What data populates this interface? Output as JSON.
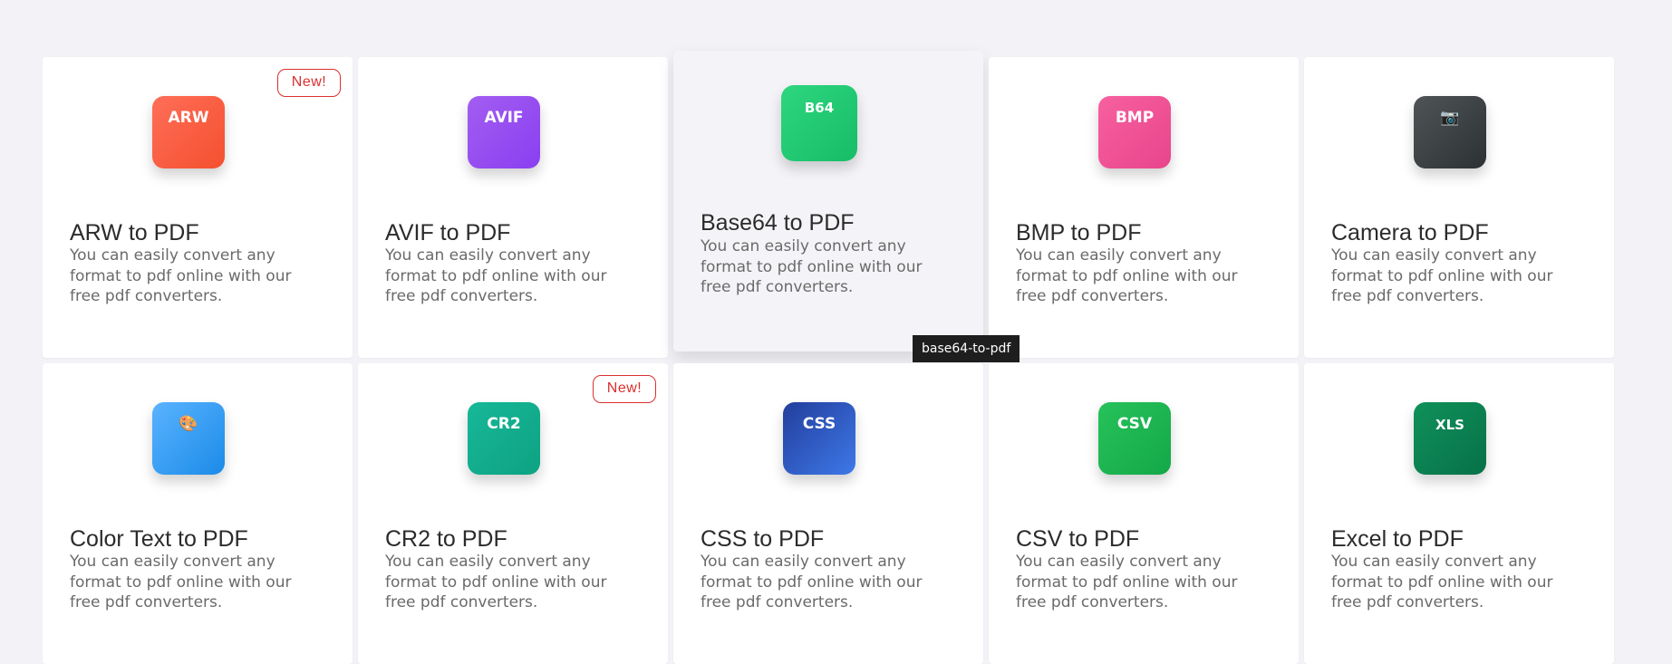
{
  "cards": [
    {
      "title": "ARW to PDF",
      "icon_text": "ARW",
      "description": "You can easily convert any format to pdf online with our free pdf converters.",
      "badge": "New!"
    },
    {
      "title": "AVIF to PDF",
      "icon_text": "AVIF",
      "description": "You can easily convert any format to pdf online with our free pdf converters."
    },
    {
      "title": "Base64 to PDF",
      "icon_text": "B64",
      "description": "You can easily convert any format to pdf online with our free pdf converters."
    },
    {
      "title": "BMP to PDF",
      "icon_text": "BMP",
      "description": "You can easily convert any format to pdf online with our free pdf converters."
    },
    {
      "title": "Camera to PDF",
      "icon_text": "📷",
      "description": "You can easily convert any format to pdf online with our free pdf converters."
    },
    {
      "title": "Color Text to PDF",
      "icon_text": "🎨",
      "description": "You can easily convert any format to pdf online with our free pdf converters."
    },
    {
      "title": "CR2 to PDF",
      "icon_text": "CR2",
      "description": "You can easily convert any format to pdf online with our free pdf converters.",
      "badge": "New!"
    },
    {
      "title": "CSS to PDF",
      "icon_text": "CSS",
      "description": "You can easily convert any format to pdf online with our free pdf converters."
    },
    {
      "title": "CSV to PDF",
      "icon_text": "CSV",
      "description": "You can easily convert any format to pdf online with our free pdf converters."
    },
    {
      "title": "Excel to PDF",
      "icon_text": "XLS",
      "description": "You can easily convert any format to pdf online with our free pdf converters."
    }
  ],
  "tooltip": "base64-to-pdf"
}
